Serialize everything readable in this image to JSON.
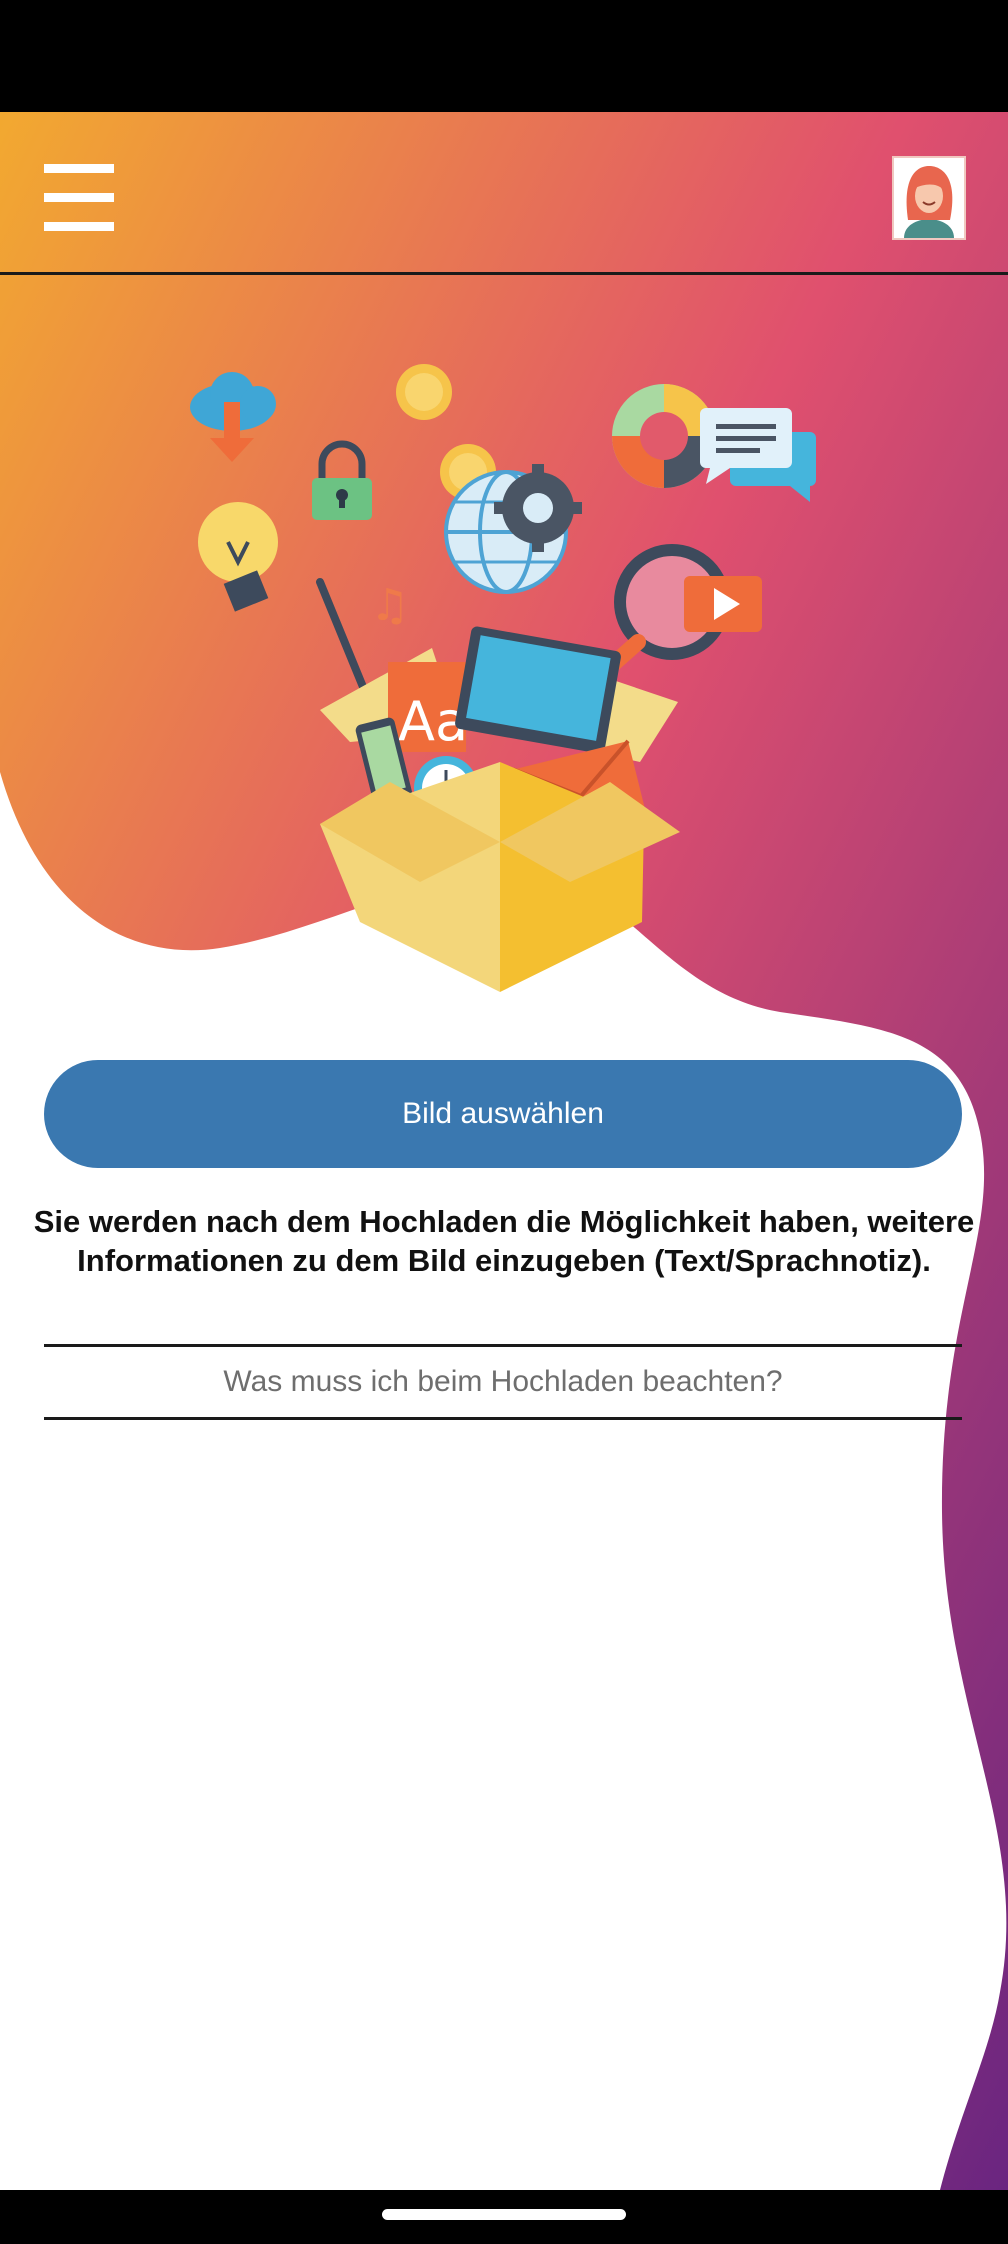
{
  "app_bar": {
    "menu_icon": "hamburger-menu-icon",
    "avatar_icon": "user-avatar-icon"
  },
  "illustration": {
    "icon": "upload-box-illustration"
  },
  "main": {
    "select_button_label": "Bild auswählen",
    "info_text": "Sie werden nach dem Hochladen die Möglichkeit haben, weitere Informationen zu dem Bild einzugeben (Text/Sprachnotiz).",
    "help_link": "Was muss ich beim Hochladen beachten?"
  },
  "colors": {
    "gradient_start": "#f2a930",
    "gradient_mid": "#e0506e",
    "gradient_end": "#6a2580",
    "button": "#3a78b0"
  }
}
